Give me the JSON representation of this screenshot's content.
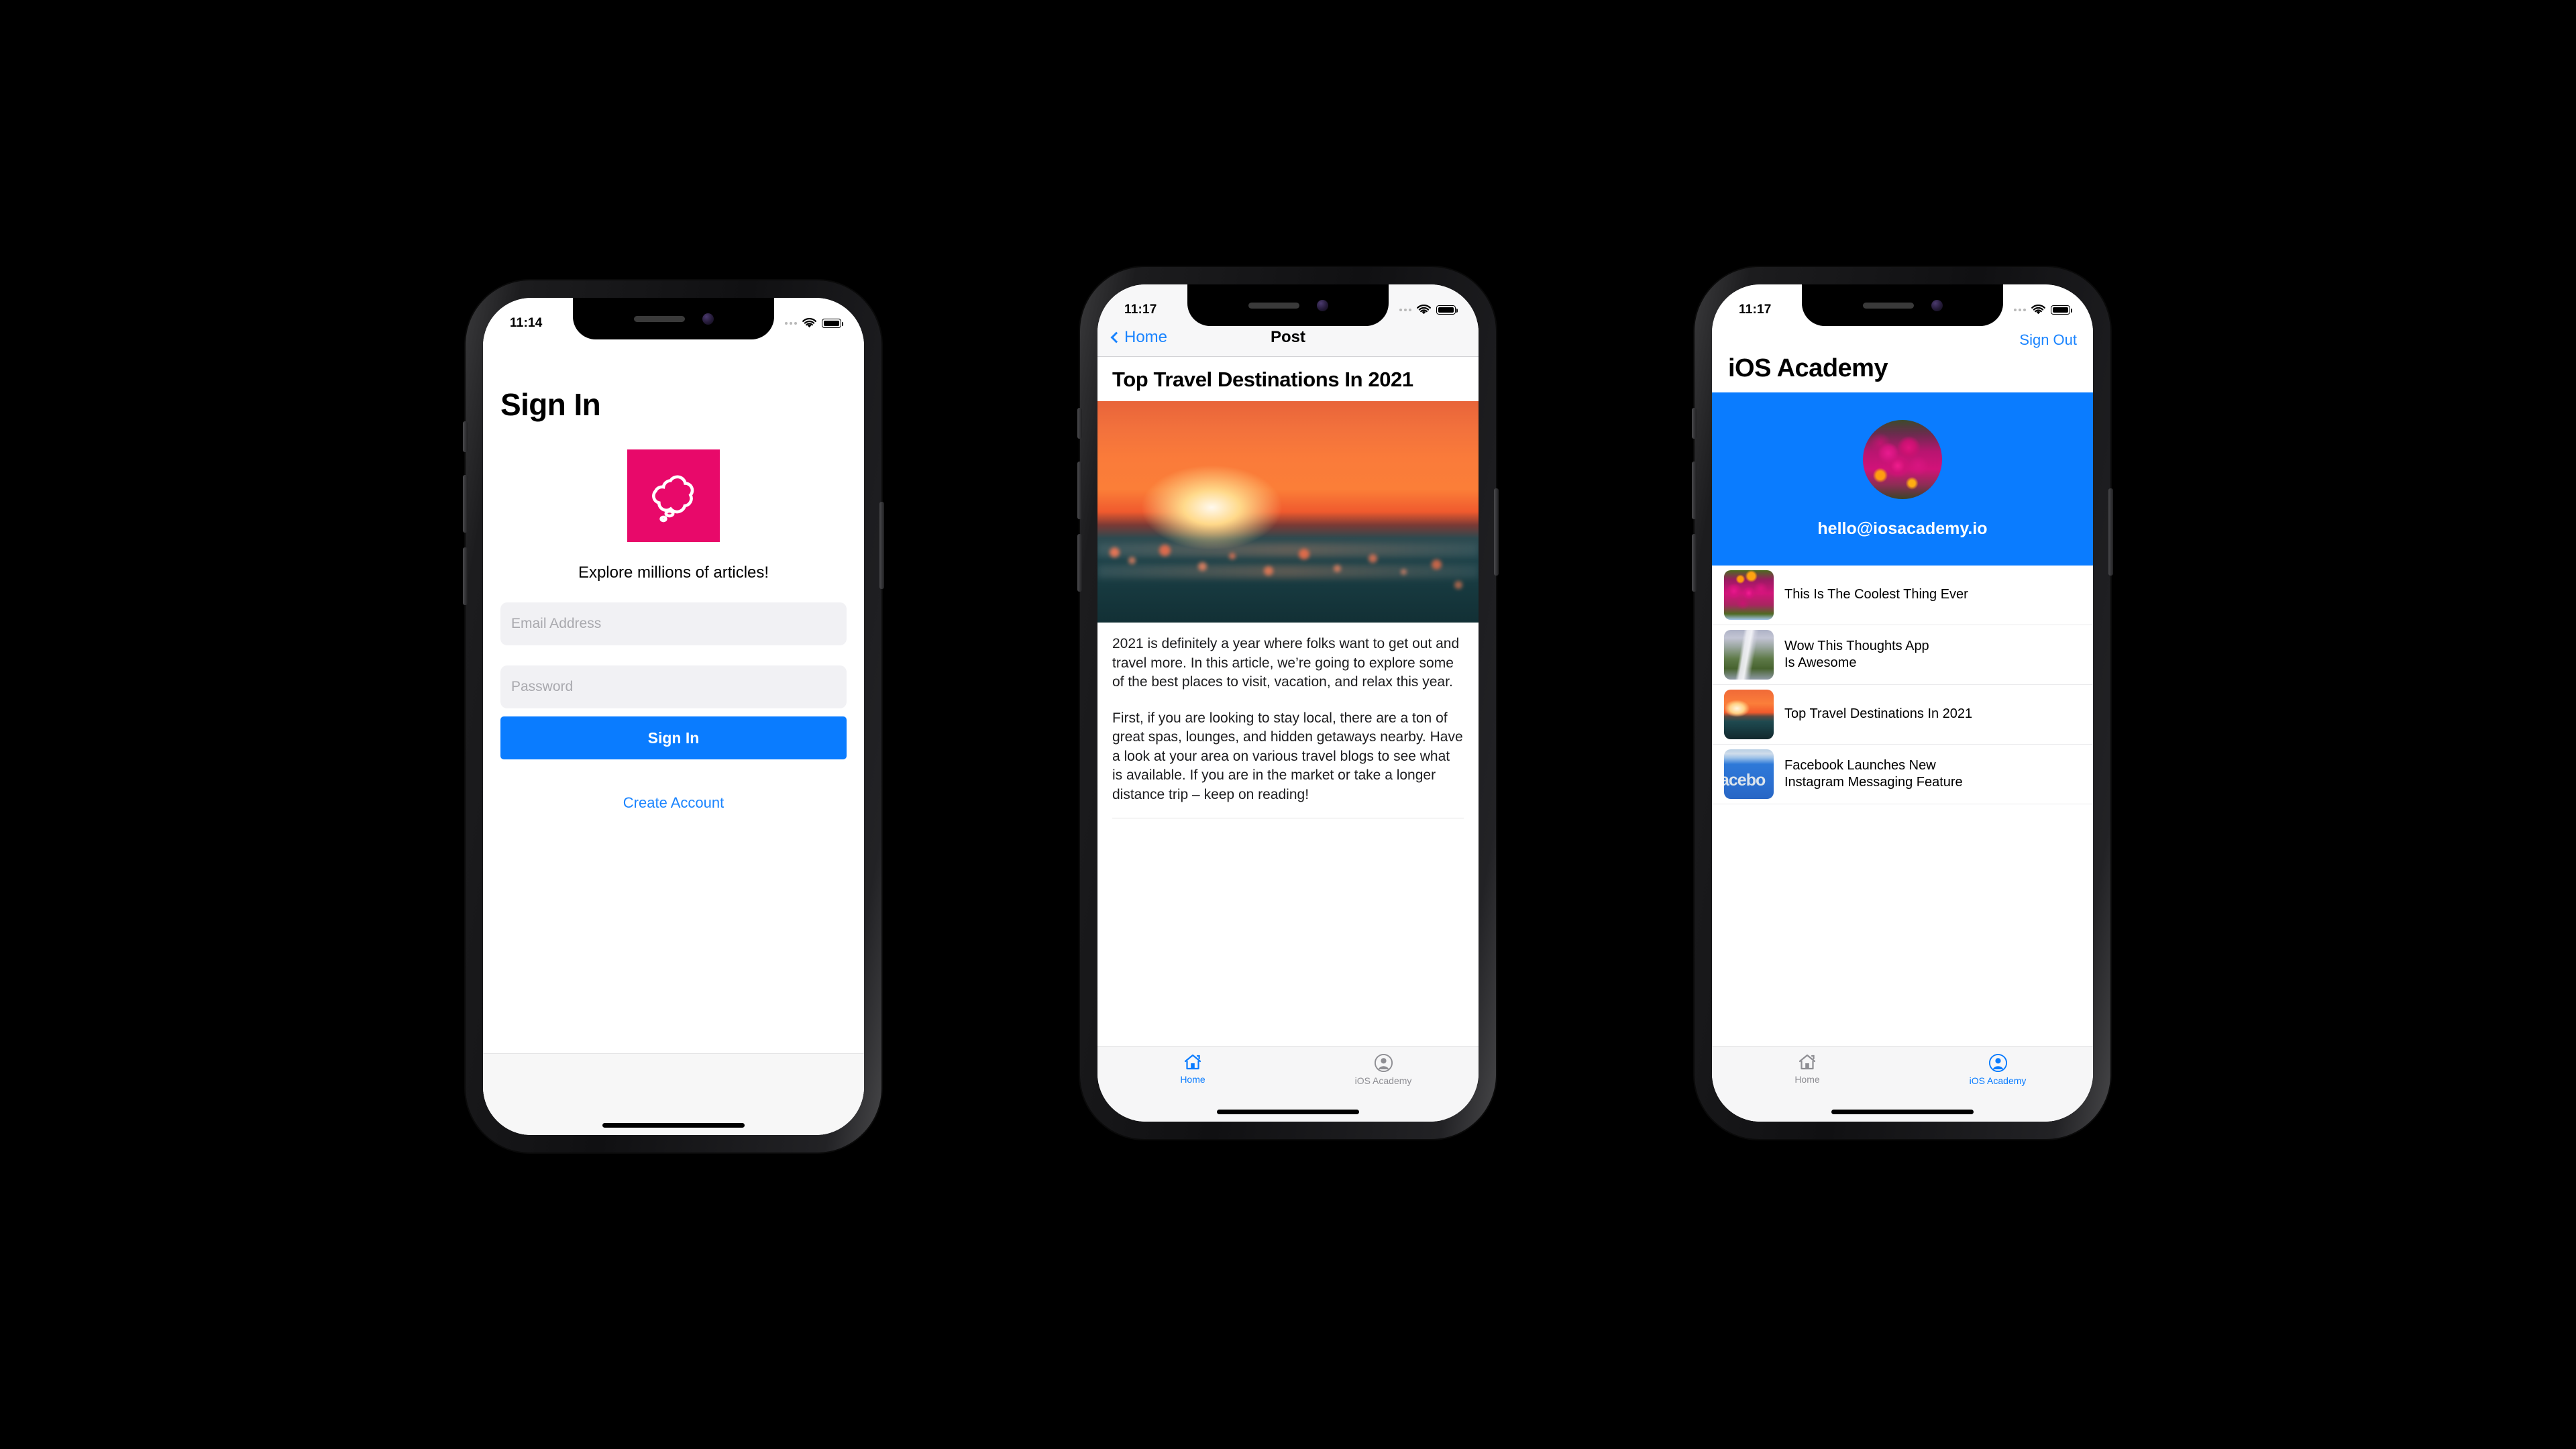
{
  "phones": [
    {
      "id": "signin",
      "status_bar": {
        "time": "11:14",
        "wifi_icon": "wifi-icon",
        "battery_icon": "battery-icon"
      },
      "title": "Sign In",
      "logo_icon": "thought-bubble-logo-icon",
      "tagline": "Explore millions of articles!",
      "fields": [
        {
          "name": "email",
          "placeholder": "Email Address",
          "value": ""
        },
        {
          "name": "password",
          "placeholder": "Password",
          "value": ""
        }
      ],
      "primary_button": "Sign In",
      "secondary_link": "Create Account",
      "colors": {
        "accent": "#0a7cff",
        "logo_bg": "#E8096A",
        "field_bg": "#f1f1f4"
      }
    },
    {
      "id": "post",
      "status_bar": {
        "time": "11:17",
        "wifi_icon": "wifi-icon",
        "battery_icon": "battery-icon"
      },
      "nav": {
        "back_label": "Home",
        "back_icon": "chevron-left-icon",
        "title": "Post"
      },
      "post_title": "Top Travel Destinations In 2021",
      "hero_image": "sunset-over-ocean-photo",
      "paragraphs": [
        "2021 is definitely a year where folks want to get out and travel more. In this article, we’re going to explore some of the best places to visit, vacation, and relax this year.",
        "First, if you are looking to stay local, there are a ton of great spas, lounges, and hidden getaways nearby. Have a look at your area on various travel blogs to see what is available. If you are in the market or take a longer distance trip – keep on reading!"
      ],
      "tabs": [
        {
          "label": "Home",
          "icon": "home-icon",
          "active": true
        },
        {
          "label": "iOS Academy",
          "icon": "person-circle-icon",
          "active": false
        }
      ]
    },
    {
      "id": "academy",
      "status_bar": {
        "time": "11:17",
        "wifi_icon": "wifi-icon",
        "battery_icon": "battery-icon"
      },
      "sign_out_label": "Sign Out",
      "page_title": "iOS Academy",
      "profile": {
        "avatar_icon": "user-avatar-flowers-photo",
        "email": "hello@iosacademy.io",
        "header_color": "#0a7cff"
      },
      "posts": [
        {
          "title": "This Is The Coolest Thing Ever",
          "thumb": "pink-flowers-photo"
        },
        {
          "title": "Wow This Thoughts App\nIs Awesome",
          "thumb": "waterfall-photo"
        },
        {
          "title": "Top Travel Destinations In 2021",
          "thumb": "sunset-ocean-photo"
        },
        {
          "title": "Facebook Launches New\nInstagram Messaging Feature",
          "thumb": "facebook-sign-photo"
        }
      ],
      "tabs": [
        {
          "label": "Home",
          "icon": "home-icon",
          "active": false
        },
        {
          "label": "iOS Academy",
          "icon": "person-circle-icon",
          "active": true
        }
      ]
    }
  ]
}
